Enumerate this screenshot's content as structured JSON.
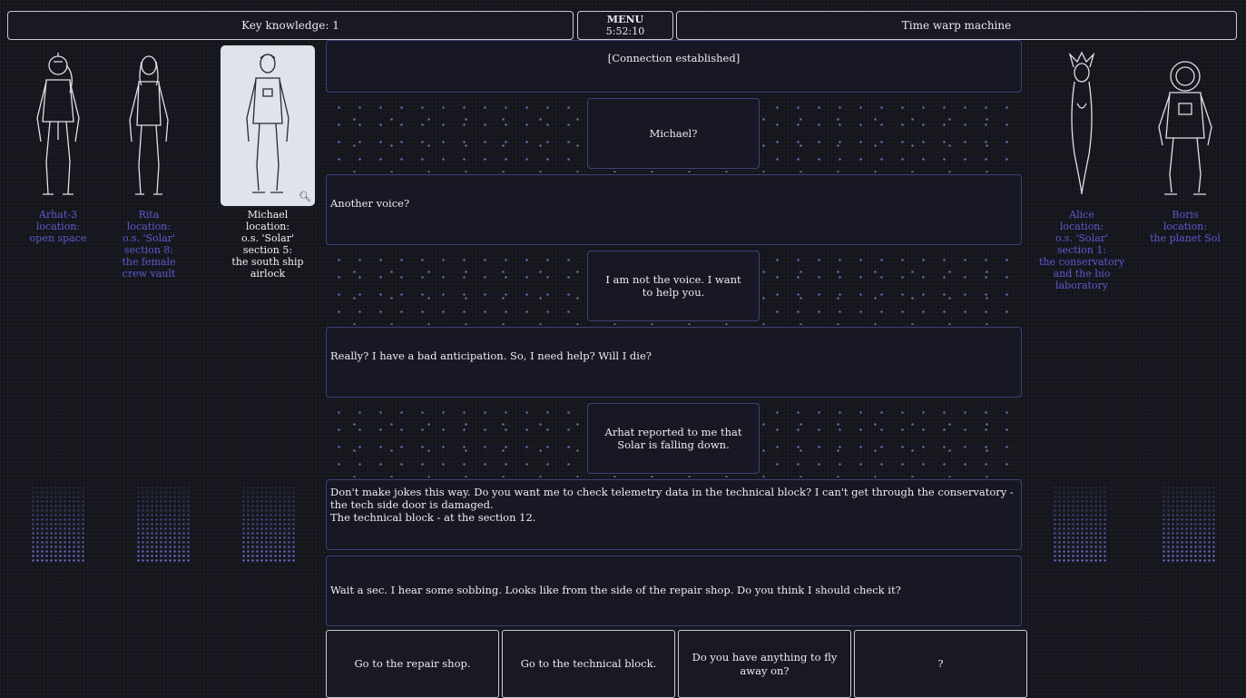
{
  "header": {
    "key_knowledge": "Key knowledge: 1",
    "menu_label": "MENU",
    "timer": "5:52:10",
    "location_title": "Time warp machine"
  },
  "characters_left": [
    {
      "name": "Arhat-3",
      "location_label": "location:",
      "l1": "open space",
      "l2": "",
      "l3": "",
      "l4": ""
    },
    {
      "name": "Rita",
      "location_label": "location:",
      "l1": "o.s. 'Solar'",
      "l2": "section 8:",
      "l3": "the female",
      "l4": "crew vault"
    },
    {
      "name": "Michael",
      "location_label": "location:",
      "l1": "o.s. 'Solar'",
      "l2": "section 5:",
      "l3": "the south ship",
      "l4": "airlock"
    }
  ],
  "characters_right": [
    {
      "name": "Alice",
      "location_label": "location:",
      "l1": "o.s. 'Solar'",
      "l2": "section 1:",
      "l3": "the conservatory",
      "l4": "and the bio",
      "l5": "laboratory"
    },
    {
      "name": "Boris",
      "location_label": "location:",
      "l1": "the planet Sol"
    }
  ],
  "dialog": {
    "status": "[Connection established]",
    "msg1": "Michael?",
    "msg2": "Another voice?",
    "msg3": "I am not the voice. I want to help you.",
    "msg4": "Really?  I have a bad anticipation.  So, I need help?  Will I die?",
    "msg5": "Arhat reported to me that Solar is falling down.",
    "msg6_l1": "Don't make jokes this way.  Do you want me to check telemetry data in the technical block?  I can't get through the conservatory - the tech side door is damaged.",
    "msg6_l2": "The technical block - at the section 12.",
    "msg7": "Wait a sec. I hear some sobbing. Looks like from the side of the repair shop. Do you think I should check it?"
  },
  "choices": [
    "Go to the repair shop.",
    "Go to the technical block.",
    "Do you have anything to fly away on?",
    "?"
  ],
  "icons": {
    "zoom": "magnifier-icon"
  },
  "colors": {
    "accent_text": "#5a5ad0",
    "background": "#14151c",
    "panel_border": "#40407a"
  }
}
